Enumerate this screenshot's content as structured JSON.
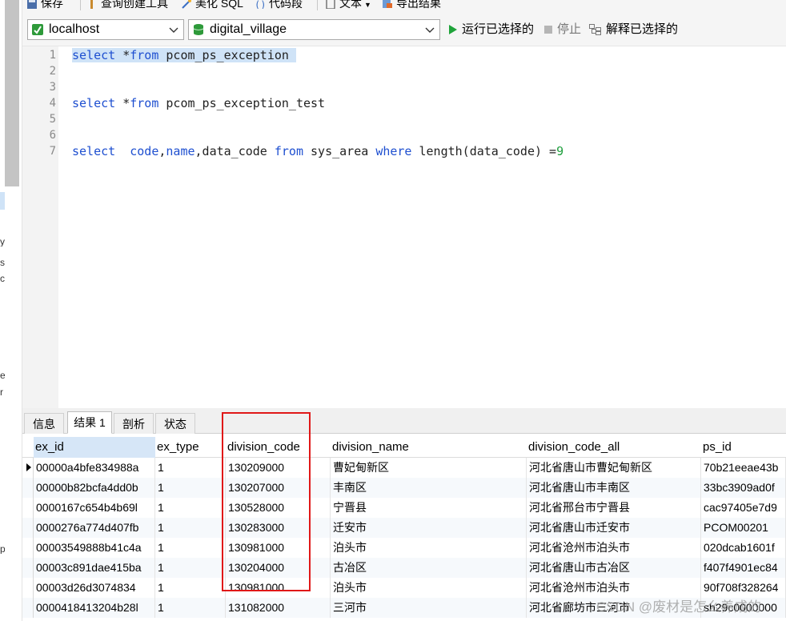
{
  "toolbar_top": {
    "save_label": "保存",
    "query_builder_label": "查询创建工具",
    "beautify_label": "美化 SQL",
    "snippet_label": "代码段",
    "text_label": "文本",
    "export_label": "导出结果"
  },
  "toolbar": {
    "connection": "localhost",
    "database": "digital_village",
    "run_selected_label": "运行已选择的",
    "stop_label": "停止",
    "explain_selected_label": "解释已选择的"
  },
  "editor": {
    "line_numbers": [
      "1",
      "2",
      "3",
      "4",
      "5",
      "6",
      "7"
    ],
    "line1": {
      "kw1": "select",
      "rest1": " *",
      "kw2": "from",
      "rest2": " pcom_ps_exception "
    },
    "line4": {
      "kw1": "select",
      "rest1": " *",
      "kw2": "from",
      "rest2": " pcom_ps_exception_test"
    },
    "line7": {
      "kw1": "select",
      "sp1": "  ",
      "kw2": "code",
      "c1": ",",
      "kw3": "name",
      "c2": ",data_code ",
      "kw4": "from",
      "t1": " sys_area ",
      "kw5": "where",
      "t2": " length(data_code) =",
      "num": "9"
    }
  },
  "result_tabs": [
    "信息",
    "结果 1",
    "剖析",
    "状态"
  ],
  "grid": {
    "columns": [
      "ex_id",
      "ex_type",
      "division_code",
      "division_name",
      "division_code_all",
      "ps_id"
    ],
    "rows": [
      [
        "00000a4bfe834988a",
        "1",
        "130209000",
        "曹妃甸新区",
        "河北省唐山市曹妃甸新区",
        "70b21eeae43b"
      ],
      [
        "00000b82bcfa4dd0b",
        "1",
        "130207000",
        "丰南区",
        "河北省唐山市丰南区",
        "33bc3909ad0f"
      ],
      [
        "0000167c654b4b69l",
        "1",
        "130528000",
        "宁晋县",
        "河北省邢台市宁晋县",
        "cac97405e7d9"
      ],
      [
        "0000276a774d407fb",
        "1",
        "130283000",
        "迁安市",
        "河北省唐山市迁安市",
        "PCOM00201"
      ],
      [
        "00003549888b41c4a",
        "1",
        "130981000",
        "泊头市",
        "河北省沧州市泊头市",
        "020dcab1601f"
      ],
      [
        "00003c891dae415ba",
        "1",
        "130204000",
        "古冶区",
        "河北省唐山市古冶区",
        "f407f4901ec84"
      ],
      [
        "00003d26d3074834",
        "1",
        "130981000",
        "泊头市",
        "河北省沧州市泊头市",
        "90f708f328264"
      ],
      [
        "0000418413204b28l",
        "1",
        "131082000",
        "三河市",
        "河北省廊坊市三河市",
        "sh29c0000000"
      ]
    ]
  },
  "watermark": "CSDN @废材是怎么养成的",
  "left_fragments": [
    "y",
    "s",
    "c",
    "e",
    "r",
    "p"
  ],
  "colors": {
    "keyword": "#1e4fd0",
    "number": "#1d9e3c",
    "selection": "#cfe3f7",
    "annotation": "#e01818",
    "run_icon": "#1fa33a"
  }
}
